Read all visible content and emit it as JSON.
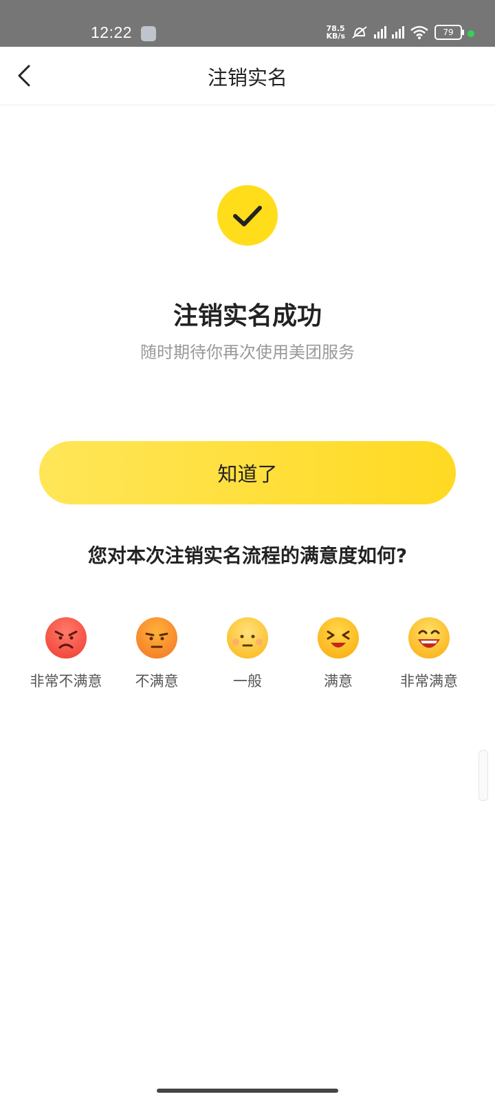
{
  "status_bar": {
    "time": "12:22",
    "speed_value": "78.5",
    "speed_unit": "KB/s",
    "battery": "79"
  },
  "nav": {
    "title": "注销实名"
  },
  "result": {
    "title": "注销实名成功",
    "subtitle": "随时期待你再次使用美团服务"
  },
  "confirm_button": "知道了",
  "survey": {
    "question": "您对本次注销实名流程的满意度如何?",
    "options": [
      {
        "label": "非常不满意",
        "icon": "very-angry-face-icon"
      },
      {
        "label": "不满意",
        "icon": "angry-face-icon"
      },
      {
        "label": "一般",
        "icon": "neutral-face-icon"
      },
      {
        "label": "满意",
        "icon": "happy-face-icon"
      },
      {
        "label": "非常满意",
        "icon": "very-happy-face-icon"
      }
    ]
  },
  "colors": {
    "accent_yellow": "#ffdd1a",
    "status_bar_bg": "#767676"
  }
}
